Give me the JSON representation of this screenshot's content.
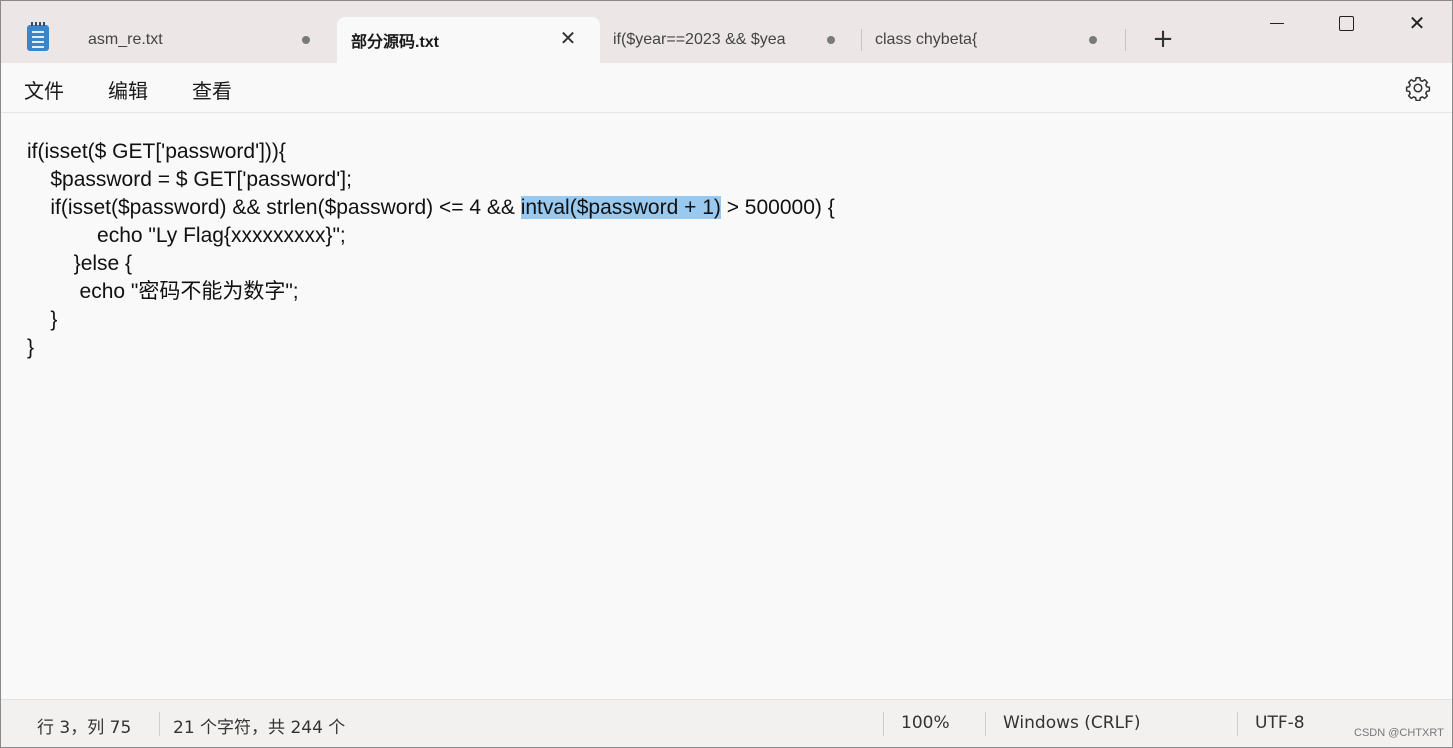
{
  "tabs": [
    {
      "label": "asm_re.txt",
      "unsaved": true
    },
    {
      "label": "部分源码.txt",
      "active": true
    },
    {
      "label": "if($year==2023 && $yea",
      "unsaved": true
    },
    {
      "label": "class chybeta{",
      "unsaved": true
    }
  ],
  "window_controls": {
    "new_tab": "+",
    "minimize": "minimize",
    "maximize": "maximize",
    "close": "✕"
  },
  "menu": [
    "文件",
    "编辑",
    "查看"
  ],
  "icons": {
    "app": "notepad-icon",
    "settings": "gear-icon",
    "close_tab": "close-icon"
  },
  "code": {
    "lines": [
      "if(isset($ GET['password'])){",
      "    $password = $ GET['password'];",
      "    if(isset($password) && strlen($password) <= 4 && ",
      "            echo \"Ly Flag{xxxxxxxxx}\";",
      "        }else {",
      "         echo \"密码不能为数字\";",
      "    }",
      "}"
    ],
    "selected_text": "intval($password + 1)",
    "after_selection": " > 500000) {"
  },
  "status": {
    "position": "行 3，列 75",
    "selection": "21 个字符，共 244 个",
    "zoom": "100%",
    "line_ending": "Windows (CRLF)",
    "encoding": "UTF-8"
  },
  "watermark": "CSDN @CHTXRT",
  "colors": {
    "selection": "#99c9ef",
    "tabstrip": "#ede6e6",
    "editor_bg": "#f9f9f9"
  }
}
